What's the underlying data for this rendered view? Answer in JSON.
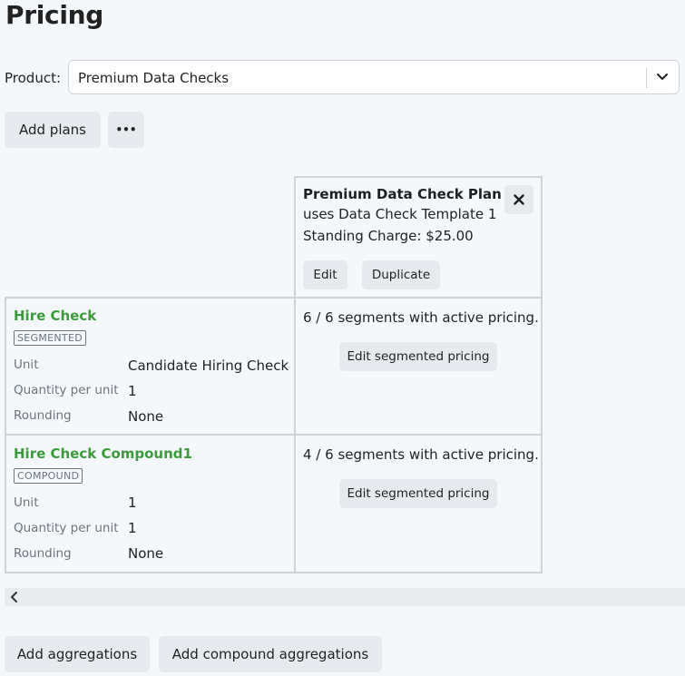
{
  "page": {
    "title": "Pricing"
  },
  "product": {
    "label": "Product:",
    "selected": "Premium Data Checks"
  },
  "toolbar": {
    "add_plans": "Add plans",
    "more": "•••"
  },
  "plan": {
    "name": "Premium Data Check Plan",
    "template": "uses Data Check Template 1",
    "standing_charge": "Standing Charge: $25.00",
    "edit": "Edit",
    "duplicate": "Duplicate",
    "close": "×"
  },
  "aggregations": [
    {
      "name": "Hire Check",
      "type": "SEGMENTED",
      "fields": [
        {
          "label": "Unit",
          "value": "Candidate Hiring Check"
        },
        {
          "label": "Quantity per unit",
          "value": "1"
        },
        {
          "label": "Rounding",
          "value": "None"
        }
      ],
      "segments_text": "6 / 6 segments with active pricing.",
      "edit_label": "Edit segmented pricing"
    },
    {
      "name": "Hire Check Compound1",
      "type": "COMPOUND",
      "fields": [
        {
          "label": "Unit",
          "value": "1"
        },
        {
          "label": "Quantity per unit",
          "value": "1"
        },
        {
          "label": "Rounding",
          "value": "None"
        }
      ],
      "segments_text": "4 / 6 segments with active pricing.",
      "edit_label": "Edit segmented pricing"
    }
  ],
  "footer": {
    "add_aggregations": "Add aggregations",
    "add_compound": "Add compound aggregations"
  }
}
